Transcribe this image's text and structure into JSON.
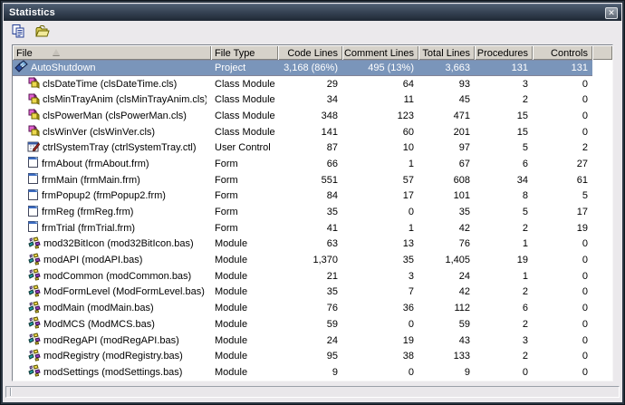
{
  "window": {
    "title": "Statistics"
  },
  "titlebar": {
    "close_label": "✕"
  },
  "toolbar": {
    "buttons": [
      {
        "name": "copy",
        "icon": "copy-icon"
      },
      {
        "name": "open-folder",
        "icon": "open-folder-icon"
      }
    ]
  },
  "table": {
    "columns": [
      {
        "key": "file",
        "label": "File",
        "align": "left",
        "sorted": "asc"
      },
      {
        "key": "type",
        "label": "File Type",
        "align": "left"
      },
      {
        "key": "code",
        "label": "Code Lines",
        "align": "right"
      },
      {
        "key": "comment",
        "label": "Comment Lines",
        "align": "right"
      },
      {
        "key": "total",
        "label": "Total Lines",
        "align": "right"
      },
      {
        "key": "proc",
        "label": "Procedures",
        "align": "right"
      },
      {
        "key": "ctrl",
        "label": "Controls",
        "align": "right"
      }
    ],
    "rows": [
      {
        "file": "AutoShutdown",
        "icon": "project-icon",
        "level": 0,
        "selected": true,
        "type": "Project",
        "code": "3,168 (86%)",
        "comment": "495 (13%)",
        "total": "3,663",
        "proc": "131",
        "ctrl": "131"
      },
      {
        "file": "clsDateTime (clsDateTime.cls)",
        "icon": "class-icon",
        "level": 1,
        "type": "Class Module",
        "code": "29",
        "comment": "64",
        "total": "93",
        "proc": "3",
        "ctrl": "0"
      },
      {
        "file": "clsMinTrayAnim (clsMinTrayAnim.cls)",
        "icon": "class-icon",
        "level": 1,
        "type": "Class Module",
        "code": "34",
        "comment": "11",
        "total": "45",
        "proc": "2",
        "ctrl": "0"
      },
      {
        "file": "clsPowerMan (clsPowerMan.cls)",
        "icon": "class-icon",
        "level": 1,
        "type": "Class Module",
        "code": "348",
        "comment": "123",
        "total": "471",
        "proc": "15",
        "ctrl": "0"
      },
      {
        "file": "clsWinVer (clsWinVer.cls)",
        "icon": "class-icon",
        "level": 1,
        "type": "Class Module",
        "code": "141",
        "comment": "60",
        "total": "201",
        "proc": "15",
        "ctrl": "0"
      },
      {
        "file": "ctrlSystemTray (ctrlSystemTray.ctl)",
        "icon": "usercontrol-icon",
        "level": 1,
        "type": "User Control",
        "code": "87",
        "comment": "10",
        "total": "97",
        "proc": "5",
        "ctrl": "2"
      },
      {
        "file": "frmAbout (frmAbout.frm)",
        "icon": "form-icon",
        "level": 1,
        "type": "Form",
        "code": "66",
        "comment": "1",
        "total": "67",
        "proc": "6",
        "ctrl": "27"
      },
      {
        "file": "frmMain (frmMain.frm)",
        "icon": "form-icon",
        "level": 1,
        "type": "Form",
        "code": "551",
        "comment": "57",
        "total": "608",
        "proc": "34",
        "ctrl": "61"
      },
      {
        "file": "frmPopup2 (frmPopup2.frm)",
        "icon": "form-icon",
        "level": 1,
        "type": "Form",
        "code": "84",
        "comment": "17",
        "total": "101",
        "proc": "8",
        "ctrl": "5"
      },
      {
        "file": "frmReg (frmReg.frm)",
        "icon": "form-icon",
        "level": 1,
        "type": "Form",
        "code": "35",
        "comment": "0",
        "total": "35",
        "proc": "5",
        "ctrl": "17"
      },
      {
        "file": "frmTrial (frmTrial.frm)",
        "icon": "form-icon",
        "level": 1,
        "type": "Form",
        "code": "41",
        "comment": "1",
        "total": "42",
        "proc": "2",
        "ctrl": "19"
      },
      {
        "file": "mod32BitIcon (mod32BitIcon.bas)",
        "icon": "module-icon",
        "level": 1,
        "type": "Module",
        "code": "63",
        "comment": "13",
        "total": "76",
        "proc": "1",
        "ctrl": "0"
      },
      {
        "file": "modAPI (modAPI.bas)",
        "icon": "module-icon",
        "level": 1,
        "type": "Module",
        "code": "1,370",
        "comment": "35",
        "total": "1,405",
        "proc": "19",
        "ctrl": "0"
      },
      {
        "file": "modCommon (modCommon.bas)",
        "icon": "module-icon",
        "level": 1,
        "type": "Module",
        "code": "21",
        "comment": "3",
        "total": "24",
        "proc": "1",
        "ctrl": "0"
      },
      {
        "file": "ModFormLevel (ModFormLevel.bas)",
        "icon": "module-icon",
        "level": 1,
        "type": "Module",
        "code": "35",
        "comment": "7",
        "total": "42",
        "proc": "2",
        "ctrl": "0"
      },
      {
        "file": "modMain (modMain.bas)",
        "icon": "module-icon",
        "level": 1,
        "type": "Module",
        "code": "76",
        "comment": "36",
        "total": "112",
        "proc": "6",
        "ctrl": "0"
      },
      {
        "file": "ModMCS (ModMCS.bas)",
        "icon": "module-icon",
        "level": 1,
        "type": "Module",
        "code": "59",
        "comment": "0",
        "total": "59",
        "proc": "2",
        "ctrl": "0"
      },
      {
        "file": "modRegAPI (modRegAPI.bas)",
        "icon": "module-icon",
        "level": 1,
        "type": "Module",
        "code": "24",
        "comment": "19",
        "total": "43",
        "proc": "3",
        "ctrl": "0"
      },
      {
        "file": "modRegistry (modRegistry.bas)",
        "icon": "module-icon",
        "level": 1,
        "type": "Module",
        "code": "95",
        "comment": "38",
        "total": "133",
        "proc": "2",
        "ctrl": "0"
      },
      {
        "file": "modSettings (modSettings.bas)",
        "icon": "module-icon",
        "level": 1,
        "type": "Module",
        "code": "9",
        "comment": "0",
        "total": "9",
        "proc": "0",
        "ctrl": "0"
      }
    ]
  },
  "colors": {
    "selection": "#7a95ba",
    "header_face": "#d6d2ca",
    "titlebar_top": "#4d5c70",
    "titlebar_bottom": "#1e2834",
    "panel_face": "#ebe9ec"
  }
}
